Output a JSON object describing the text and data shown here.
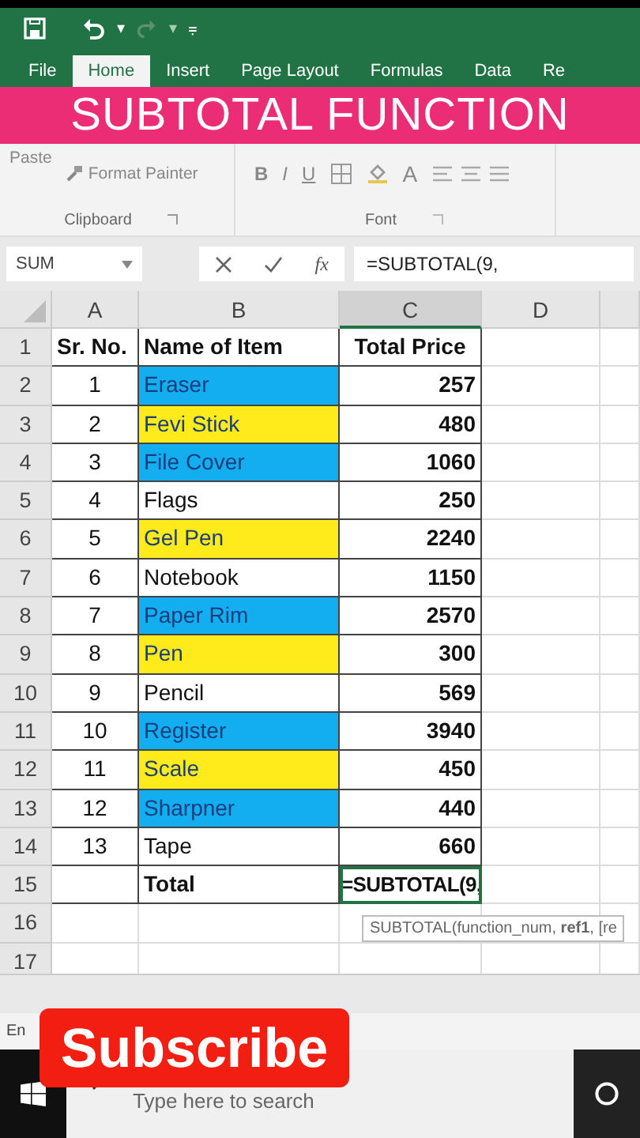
{
  "quick_access": {
    "undo_caret": "▾",
    "redo_caret": "▾",
    "customize": "⩦"
  },
  "tabs": [
    {
      "label": "File",
      "selected": false
    },
    {
      "label": "Home",
      "selected": true
    },
    {
      "label": "Insert",
      "selected": false
    },
    {
      "label": "Page Layout",
      "selected": false
    },
    {
      "label": "Formulas",
      "selected": false
    },
    {
      "label": "Data",
      "selected": false
    },
    {
      "label": "Re",
      "selected": false
    }
  ],
  "banner": "SUBTOTAL FUNCTION",
  "ribbon": {
    "paste": "Paste",
    "format_painter": "Format Painter",
    "clipboard": "Clipboard",
    "font": "Font",
    "bold": "B",
    "italic": "I",
    "underline": "U",
    "font_color": "A"
  },
  "formula_bar": {
    "name_box": "SUM",
    "fx": "fx",
    "formula": "=SUBTOTAL(9,"
  },
  "columns": [
    {
      "label": "A",
      "selected": false
    },
    {
      "label": "B",
      "selected": false
    },
    {
      "label": "C",
      "selected": true
    },
    {
      "label": "D",
      "selected": false
    }
  ],
  "row_numbers": [
    "1",
    "2",
    "3",
    "4",
    "5",
    "6",
    "7",
    "8",
    "9",
    "10",
    "11",
    "12",
    "13",
    "14",
    "15",
    "16",
    "17"
  ],
  "header": {
    "sr": "Sr. No.",
    "name": "Name of Item",
    "price": "Total Price"
  },
  "rows": [
    {
      "sr": "1",
      "name": "Eraser",
      "price": "257",
      "color": "#12aef0",
      "selected": false
    },
    {
      "sr": "2",
      "name": "Fevi Stick",
      "price": "480",
      "color": "#ffea1c",
      "selected": false
    },
    {
      "sr": "3",
      "name": "File Cover",
      "price": "1060",
      "color": "#12aef0",
      "selected": false
    },
    {
      "sr": "4",
      "name": "Flags",
      "price": "250",
      "selected": false
    },
    {
      "sr": "5",
      "name": "Gel Pen",
      "price": "2240",
      "color": "#ffea1c",
      "selected": false
    },
    {
      "sr": "6",
      "name": "Notebook",
      "price": "1150",
      "selected": false
    },
    {
      "sr": "7",
      "name": "Paper Rim",
      "price": "2570",
      "color": "#12aef0",
      "selected": false
    },
    {
      "sr": "8",
      "name": "Pen",
      "price": "300",
      "color": "#ffea1c",
      "selected": false
    },
    {
      "sr": "9",
      "name": "Pencil",
      "price": "569",
      "selected": false
    },
    {
      "sr": "10",
      "name": "Register",
      "price": "3940",
      "color": "#12aef0",
      "selected": false
    },
    {
      "sr": "11",
      "name": "Scale",
      "price": "450",
      "color": "#ffea1c",
      "selected": false
    },
    {
      "sr": "12",
      "name": "Sharpner",
      "price": "440",
      "color": "#12aef0",
      "selected": false
    },
    {
      "sr": "13",
      "name": "Tape",
      "price": "660",
      "selected": false
    }
  ],
  "total": {
    "label": "Total",
    "formula": "=SUBTOTAL(9,",
    "selected": true
  },
  "tooltip": "SUBTOTAL(function_num, **ref1**, [re",
  "status": "En",
  "subscribe": "Subscribe",
  "taskbar": {
    "search": {
      "placeholder": "Type here to search"
    }
  }
}
